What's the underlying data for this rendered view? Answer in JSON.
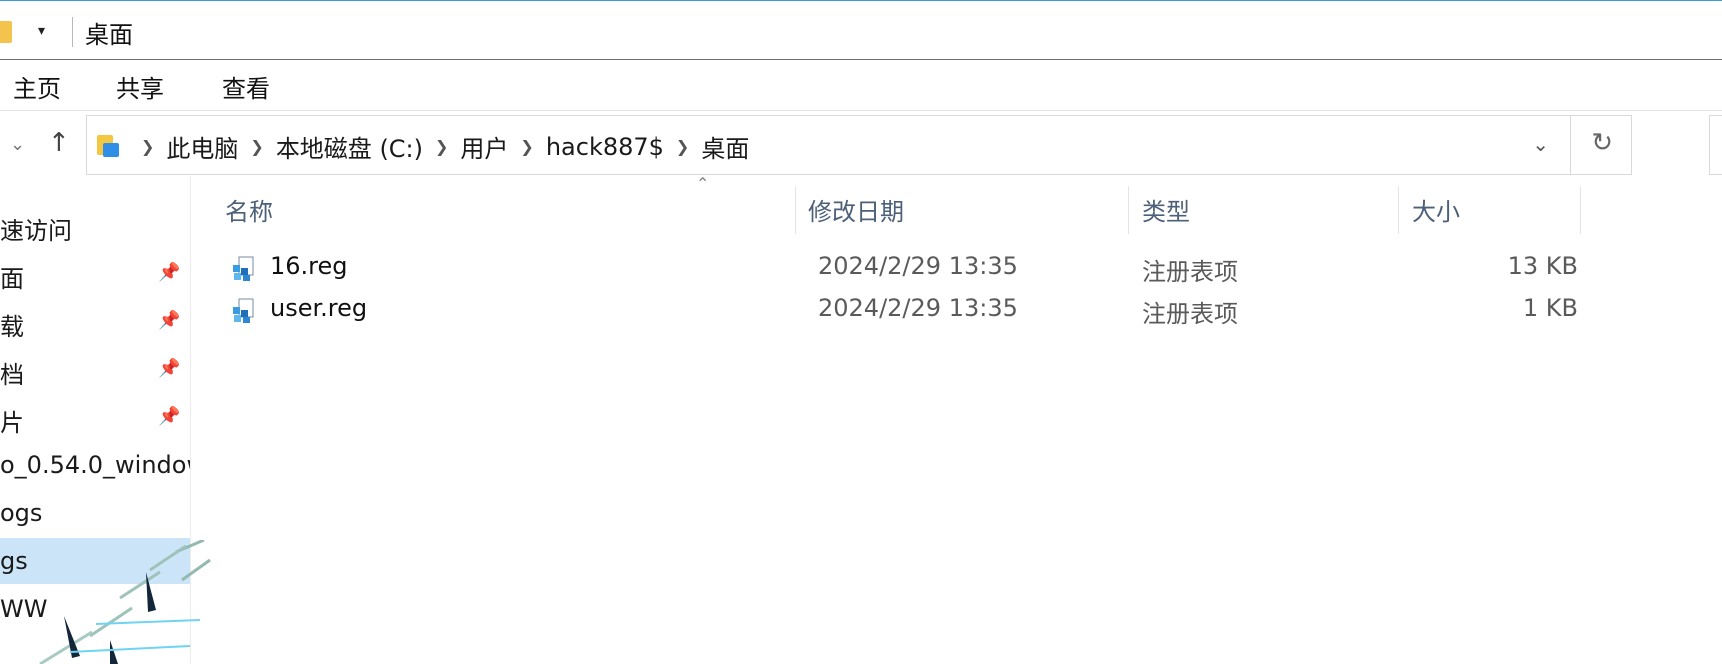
{
  "window": {
    "title": "桌面"
  },
  "ribbon": {
    "tabs": [
      "主页",
      "共享",
      "查看"
    ]
  },
  "address": {
    "crumbs": [
      "此电脑",
      "本地磁盘 (C:)",
      "用户",
      "hack887$",
      "桌面"
    ]
  },
  "icons": {
    "address_folder": "folder-icon",
    "pin": "pin-icon",
    "reg_file": "registry-file-icon",
    "refresh": "refresh-icon",
    "up": "up-arrow-icon"
  },
  "navpane": {
    "items": [
      {
        "label": "速访问",
        "pinned": false
      },
      {
        "label": "面",
        "pinned": true
      },
      {
        "label": "载",
        "pinned": true
      },
      {
        "label": "档",
        "pinned": true
      },
      {
        "label": "片",
        "pinned": true
      },
      {
        "label": "o_0.54.0_window",
        "pinned": false
      },
      {
        "label": "ogs",
        "pinned": false
      },
      {
        "label": "gs",
        "pinned": false,
        "selected": true
      },
      {
        "label": "WW",
        "pinned": false
      }
    ]
  },
  "columns": {
    "name": "名称",
    "date": "修改日期",
    "type": "类型",
    "size": "大小"
  },
  "files": [
    {
      "name": "16.reg",
      "date": "2024/2/29 13:35",
      "type": "注册表项",
      "size": "13 KB"
    },
    {
      "name": "user.reg",
      "date": "2024/2/29 13:35",
      "type": "注册表项",
      "size": "1 KB"
    }
  ],
  "colors": {
    "selection": "#cce4f7",
    "header_text": "#4c607a",
    "accent": "#3b9be0"
  }
}
